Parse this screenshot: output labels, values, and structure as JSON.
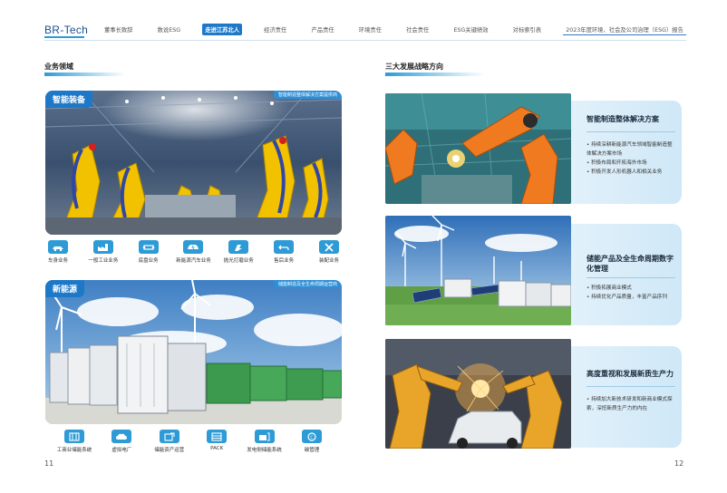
{
  "header": {
    "logo": "BR-Tech",
    "nav": [
      "董事长致辞",
      "数说ESG",
      "走进江苏北人",
      "经济责任",
      "产品责任",
      "环境责任",
      "社会责任",
      "ESG关键绩效",
      "对标索引表",
      "2023年度环境、社会及公司治理（ESG）报告"
    ],
    "active_index": 2
  },
  "left": {
    "title": "业务领域",
    "smart": {
      "tag": "智能装备",
      "corner_tag": "智能制造整体解决方案提供商",
      "items": [
        {
          "label": "车身业务",
          "icon": "car-body-icon"
        },
        {
          "label": "一般工业业务",
          "icon": "factory-icon"
        },
        {
          "label": "底盘业务",
          "icon": "chassis-icon"
        },
        {
          "label": "新能源汽车业务",
          "icon": "ev-car-icon"
        },
        {
          "label": "抛光打磨业务",
          "icon": "polishing-icon"
        },
        {
          "label": "售后业务",
          "icon": "after-sales-icon"
        },
        {
          "label": "装配业务",
          "icon": "assembly-tools-icon"
        }
      ]
    },
    "energy": {
      "tag": "新能源",
      "corner_tag": "储能制造及全生命周期运营商",
      "items": [
        {
          "label": "工商业储能系统",
          "icon": "battery-cabinet-icon"
        },
        {
          "label": "虚拟电厂",
          "icon": "cloud-plant-icon"
        },
        {
          "label": "储能资产运营",
          "icon": "asset-ops-icon"
        },
        {
          "label": "PACK",
          "icon": "pack-icon"
        },
        {
          "label": "发电侧储能系统",
          "icon": "generation-storage-icon"
        },
        {
          "label": "碳管理",
          "icon": "carbon-icon"
        }
      ]
    }
  },
  "right": {
    "title": "三大发展战略方向",
    "cards": [
      {
        "title": "智能制造整体解决方案",
        "bullets": [
          "持续深耕新能源汽车领域智能制造整体解决方案市场",
          "积极布局和开拓海外市场",
          "积极开发人形机器人和相关业务"
        ]
      },
      {
        "title": "储能产品及全生命周期数字化管理",
        "bullets": [
          "积极拓展商业模式",
          "持续优化产品质量，丰富产品序列"
        ]
      },
      {
        "title": "高度重视和发展新质生产力",
        "bullets": [
          "持续加大新技术研发和新商业模式探索，深挖新质生产力的内在"
        ]
      }
    ]
  },
  "footer": {
    "left_page": "11",
    "right_page": "12"
  },
  "colors": {
    "accent": "#1e78c8",
    "light": "#d4ebf8"
  }
}
